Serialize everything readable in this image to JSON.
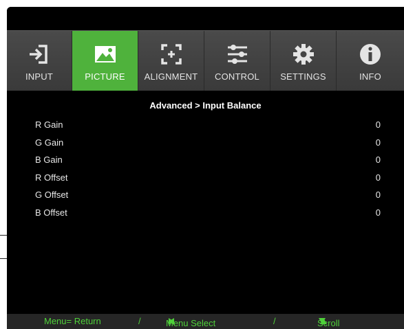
{
  "tabs": [
    {
      "label": "INPUT",
      "icon": "input-icon",
      "active": false
    },
    {
      "label": "PICTURE",
      "icon": "picture-icon",
      "active": true
    },
    {
      "label": "ALIGNMENT",
      "icon": "alignment-icon",
      "active": false
    },
    {
      "label": "CONTROL",
      "icon": "control-sliders-icon",
      "active": false
    },
    {
      "label": "SETTINGS",
      "icon": "gear-icon",
      "active": false
    },
    {
      "label": "INFO",
      "icon": "info-icon",
      "active": false
    }
  ],
  "breadcrumb": "Advanced > Input Balance",
  "rows": [
    {
      "name": "R Gain",
      "value": "0"
    },
    {
      "name": "G Gain",
      "value": "0"
    },
    {
      "name": "B Gain",
      "value": "0"
    },
    {
      "name": "R Offset",
      "value": "0"
    },
    {
      "name": "G Offset",
      "value": "0"
    },
    {
      "name": "B Offset",
      "value": "0"
    }
  ],
  "footer": {
    "menu_return": "Menu= Return",
    "sep1": "/",
    "menu_select": "Menu Select",
    "sep2": "/",
    "scroll": "Scroll"
  },
  "colors": {
    "accent": "#4fb23c",
    "footer_text": "#4fd03a",
    "tabbar": "#444444",
    "background": "#000000"
  }
}
